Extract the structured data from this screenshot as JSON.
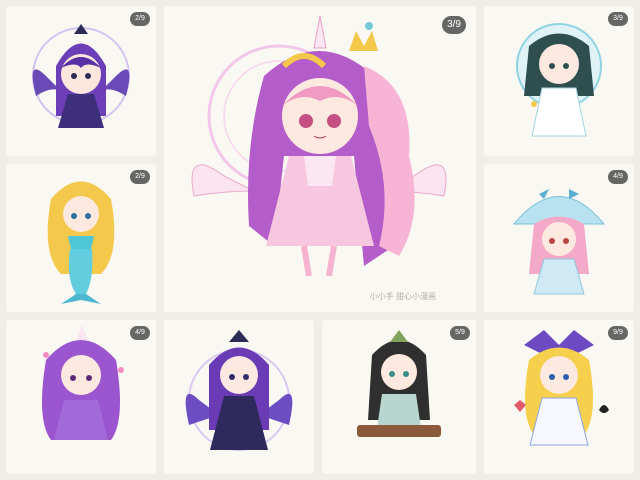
{
  "tiles": [
    {
      "id": "t1",
      "badge": "2/9",
      "art": "winged-dark-princess-icon"
    },
    {
      "id": "t2",
      "badge": "3/9",
      "art": "unicorn-angel-princess-icon",
      "watermark": "小小手 甜心小漫画"
    },
    {
      "id": "t3",
      "badge": "3/9",
      "art": "bubble-fairy-icon"
    },
    {
      "id": "t4",
      "badge": "2/9",
      "art": "mermaid-icon"
    },
    {
      "id": "t5",
      "badge": "4/9",
      "art": "jellyfish-girl-icon"
    },
    {
      "id": "t6",
      "badge": "4/9",
      "art": "purple-pony-girl-icon"
    },
    {
      "id": "t7",
      "badge": "",
      "art": "night-princess-icon"
    },
    {
      "id": "t8",
      "badge": "5/9",
      "art": "zither-girl-icon"
    },
    {
      "id": "t9",
      "badge": "9/9",
      "art": "alice-girl-icon"
    }
  ],
  "colors": {
    "background": "#f1eee9",
    "tile": "#faf8f3",
    "purple": "#7a4fc7",
    "pink": "#f5a9c9",
    "gold": "#f4c84a",
    "teal": "#77c9d8"
  }
}
